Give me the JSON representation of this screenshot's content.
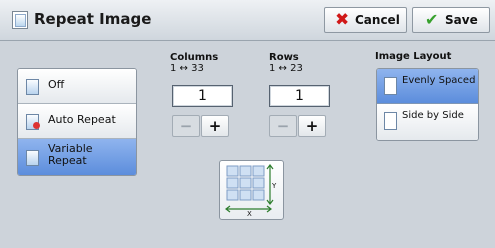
{
  "header": {
    "title": "Repeat Image",
    "cancel_label": "Cancel",
    "save_label": "Save"
  },
  "modes": [
    {
      "label": "Off",
      "selected": false
    },
    {
      "label": "Auto Repeat",
      "selected": false
    },
    {
      "label": "Variable Repeat",
      "selected": true
    }
  ],
  "columns": {
    "title": "Columns",
    "range": "1 ↔ 33",
    "value": "1"
  },
  "rows": {
    "title": "Rows",
    "range": "1 ↔ 23",
    "value": "1"
  },
  "stepper": {
    "minus": "−",
    "plus": "+"
  },
  "illustration": {
    "x_label": "X",
    "y_label": "Y"
  },
  "layout": {
    "title": "Image Layout",
    "options": [
      {
        "label": "Evenly Spaced",
        "selected": true
      },
      {
        "label": "Side by Side",
        "selected": false
      }
    ]
  },
  "colors": {
    "selected": "#6f9be2",
    "background": "#cdd3da"
  }
}
